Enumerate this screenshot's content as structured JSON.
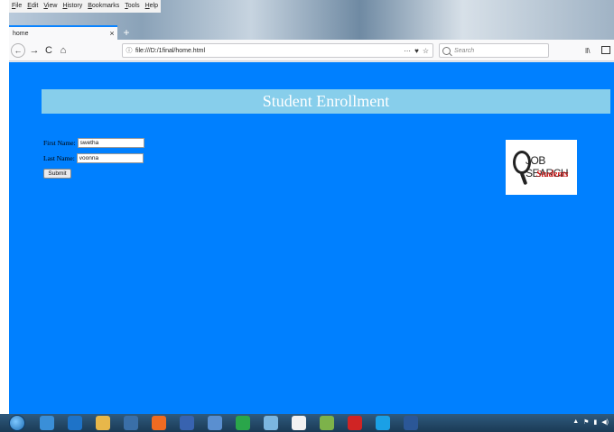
{
  "browser": {
    "menu": [
      "File",
      "Edit",
      "View",
      "History",
      "Bookmarks",
      "Tools",
      "Help"
    ],
    "tab_title": "home",
    "tab_close": "×",
    "new_tab": "+",
    "url": "file:///D:/1final/home.html",
    "url_info_icon": "ⓘ",
    "page_actions": "···",
    "pocket_icon": "♥",
    "bookmark_star": "☆",
    "search_placeholder": "Search",
    "library_icon": "ǁ\\",
    "nav": {
      "back": "←",
      "forward": "→",
      "reload": "C",
      "home": "⌂"
    }
  },
  "page": {
    "title": "Student Enrollment",
    "form": {
      "first_name_label": "First Name:",
      "first_name_value": "swetha",
      "last_name_label": "Last Name:",
      "last_name_value": "voonna",
      "submit_label": "Submit"
    },
    "logo": {
      "line1": "JOB SEARCH",
      "line2": "Students"
    },
    "background_color": "#0080ff",
    "banner_color": "#87ceeb"
  },
  "taskbar": {
    "icons": [
      "help-icon",
      "ie-icon",
      "explorer-icon",
      "media-icon",
      "firefox-icon",
      "outlook-icon",
      "edit-icon",
      "chrome-icon",
      "network-icon",
      "files-icon",
      "app-icon",
      "opera-icon",
      "skype-icon",
      "word-icon"
    ],
    "icon_colors": [
      "#3a8fd8",
      "#1e73c8",
      "#e7b74a",
      "#3a6fa8",
      "#f06b21",
      "#3863b0",
      "#5a8fd0",
      "#2aa64a",
      "#7bb6e0",
      "#f2f2f2",
      "#7db24a",
      "#d02424",
      "#1aa0e6",
      "#2b5797"
    ],
    "tray": [
      "▲",
      "⚑",
      "▮",
      "◀)"
    ]
  }
}
